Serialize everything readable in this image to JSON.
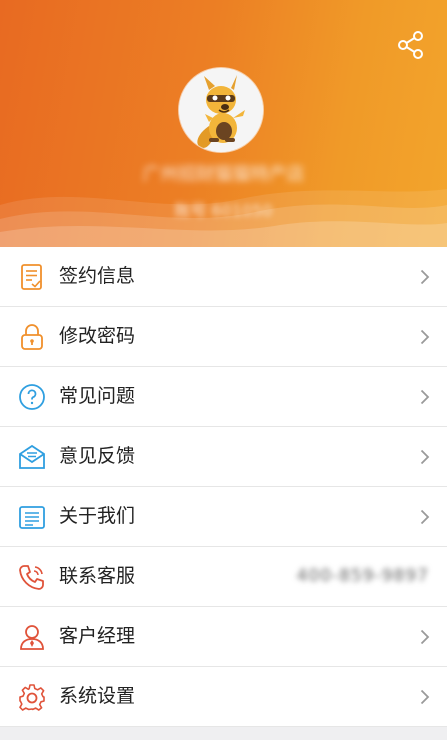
{
  "header": {
    "shop_name": "广州招财猫猫特产店",
    "account": "账号 601050"
  },
  "menu": [
    {
      "label": "签约信息",
      "icon": "contract-icon"
    },
    {
      "label": "修改密码",
      "icon": "lock-icon"
    },
    {
      "label": "常见问题",
      "icon": "question-icon"
    },
    {
      "label": "意见反馈",
      "icon": "mail-icon"
    },
    {
      "label": "关于我们",
      "icon": "document-icon"
    },
    {
      "label": "联系客服",
      "icon": "phone-icon",
      "value": "400-859-9897"
    },
    {
      "label": "客户经理",
      "icon": "person-icon"
    },
    {
      "label": "系统设置",
      "icon": "gear-icon"
    }
  ],
  "colors": {
    "header_start": "#e86a22",
    "header_end": "#f3a52c",
    "icon_orange": "#f0902c",
    "icon_blue": "#2f9fe0",
    "icon_red": "#e0533a"
  }
}
